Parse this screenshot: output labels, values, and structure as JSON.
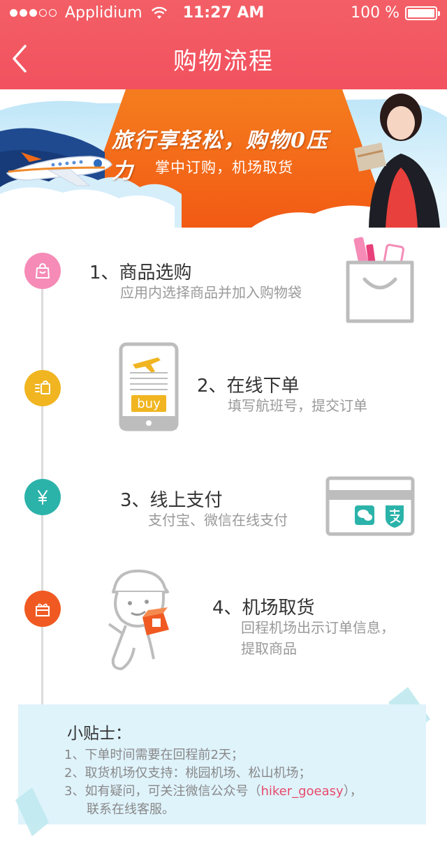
{
  "status_bar": {
    "carrier": "Applidium",
    "time": "11:27 AM",
    "battery": "100 %"
  },
  "nav": {
    "title": "购物流程"
  },
  "banner": {
    "slogan": "旅行享轻松，购物0压力",
    "subtitle": "掌中订购，机场取货"
  },
  "steps": [
    {
      "title": "1、商品选购",
      "desc": "应用内选择商品并加入购物袋",
      "color": "#f58bb6",
      "icon": "shopping-bag-icon"
    },
    {
      "title": "2、在线下单",
      "desc": "填写航班号，提交订单",
      "color": "#f0b521",
      "icon": "order-list-icon",
      "phone_label": "buy"
    },
    {
      "title": "3、线上支付",
      "desc": "支付宝、微信在线支付",
      "color": "#2bb3aa",
      "icon": "yuan-icon"
    },
    {
      "title": "4、机场取货",
      "desc_lines": [
        "回程机场出示订单信息，",
        "提取商品"
      ],
      "color": "#f05a22",
      "icon": "gift-icon"
    }
  ],
  "tips": {
    "title": "小贴士：",
    "items": [
      "1、下单时间需要在回程前2天；",
      "2、取货机场仅支持：桃园机场、松山机场；"
    ],
    "item3_prefix": "3、如有疑问，可关注微信公众号（",
    "item3_highlight": "hiker_goeasy",
    "item3_suffix": "），",
    "item3_cont": "联系在线客服。"
  }
}
